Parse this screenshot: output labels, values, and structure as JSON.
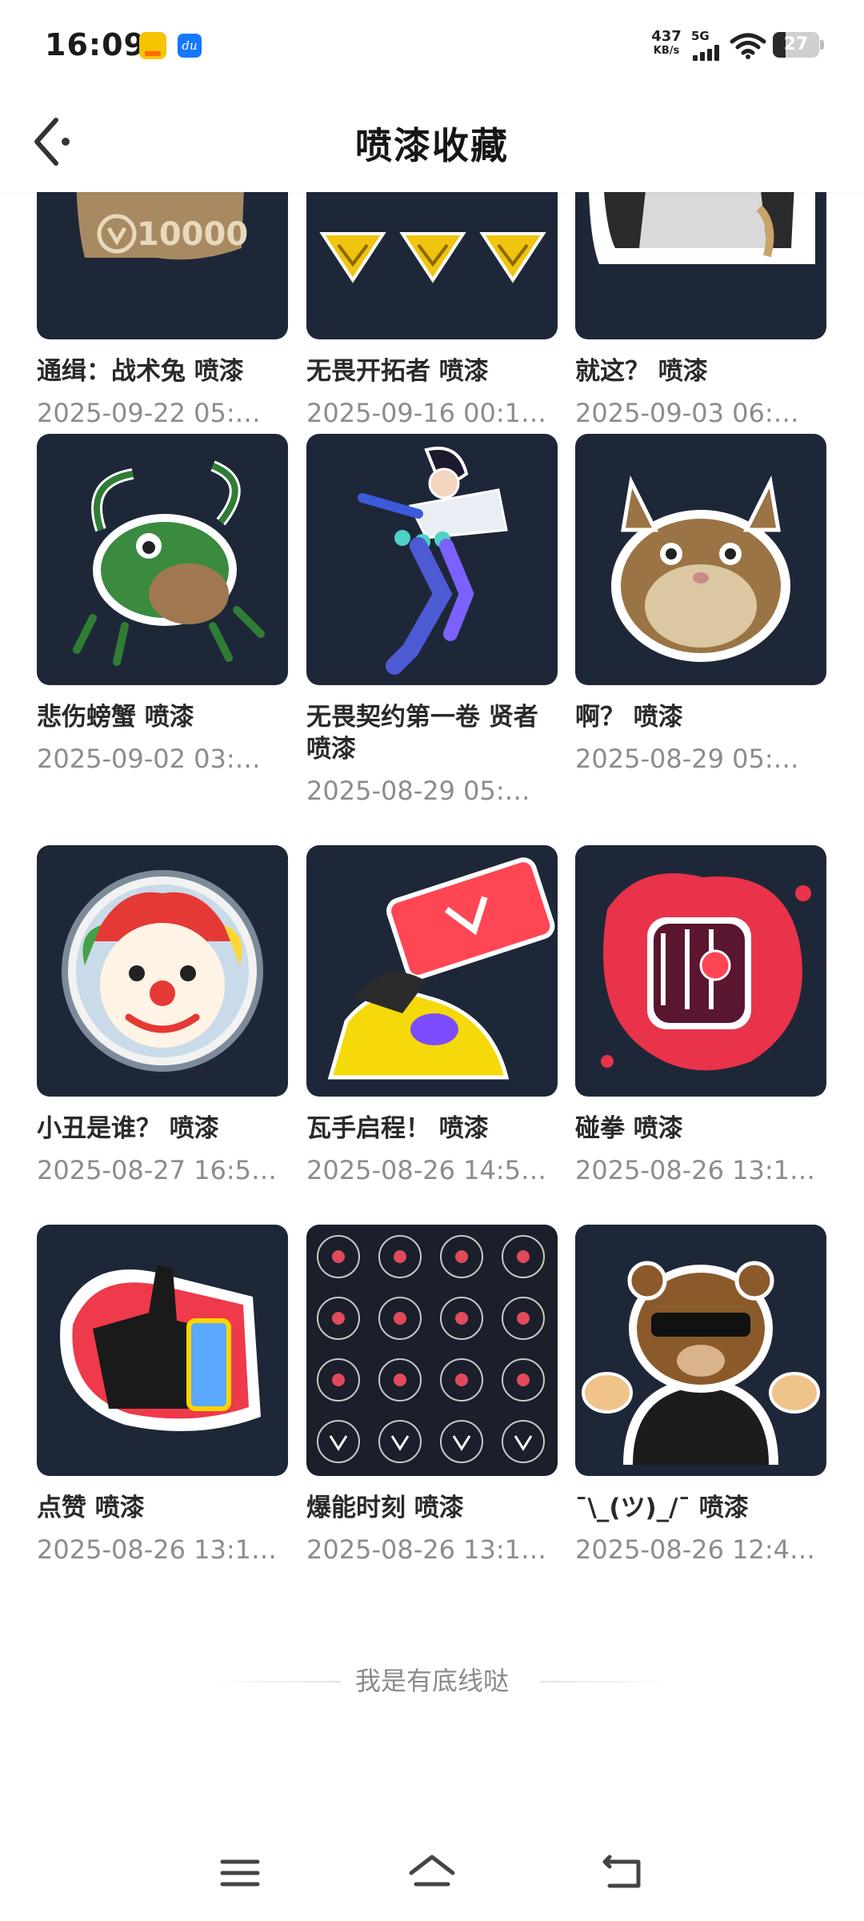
{
  "status_bar": {
    "time": "16:09",
    "net_speed_value": "437",
    "net_speed_unit": "KB/s",
    "network_type": "5G",
    "battery_level": "27",
    "icons": [
      "app-notification-icon",
      "app-notification-icon",
      "signal-icon",
      "wifi-icon",
      "battery-icon"
    ]
  },
  "header": {
    "title": "喷漆收藏",
    "back_icon": "back-arrow-icon"
  },
  "items": [
    {
      "title": "通缉：战术兔 喷漆",
      "date": "2025-09-22 05:…"
    },
    {
      "title": "无畏开拓者 喷漆",
      "date": "2025-09-16 00:1…"
    },
    {
      "title": "就这？ 喷漆",
      "date": "2025-09-03 06:…"
    },
    {
      "title": "悲伤螃蟹 喷漆",
      "date": "2025-09-02 03:…"
    },
    {
      "title": "无畏契约第一卷 贤者 喷漆",
      "date": "2025-08-29 05:…"
    },
    {
      "title": "啊？ 喷漆",
      "date": "2025-08-29 05:…"
    },
    {
      "title": "小丑是谁？ 喷漆",
      "date": "2025-08-27 16:5…"
    },
    {
      "title": "瓦手启程！ 喷漆",
      "date": "2025-08-26 14:5…"
    },
    {
      "title": "碰拳 喷漆",
      "date": "2025-08-26 13:1…"
    },
    {
      "title": "点赞 喷漆",
      "date": "2025-08-26 13:1…"
    },
    {
      "title": "爆能时刻 喷漆",
      "date": "2025-08-26 13:1…"
    },
    {
      "title": "¯\\_(ツ)_/¯ 喷漆",
      "date": "2025-08-26 12:4…"
    }
  ],
  "partial_text": {
    "wanted_poster_number": "10000"
  },
  "footer": {
    "end_text": "我是有底线哒"
  },
  "nav_bar": {
    "icons": [
      "menu-icon",
      "home-icon",
      "back-icon"
    ]
  },
  "colors": {
    "thumb_bg": "#1e2738",
    "title_text": "#2a2a2a",
    "date_text": "#8c8c8c"
  }
}
